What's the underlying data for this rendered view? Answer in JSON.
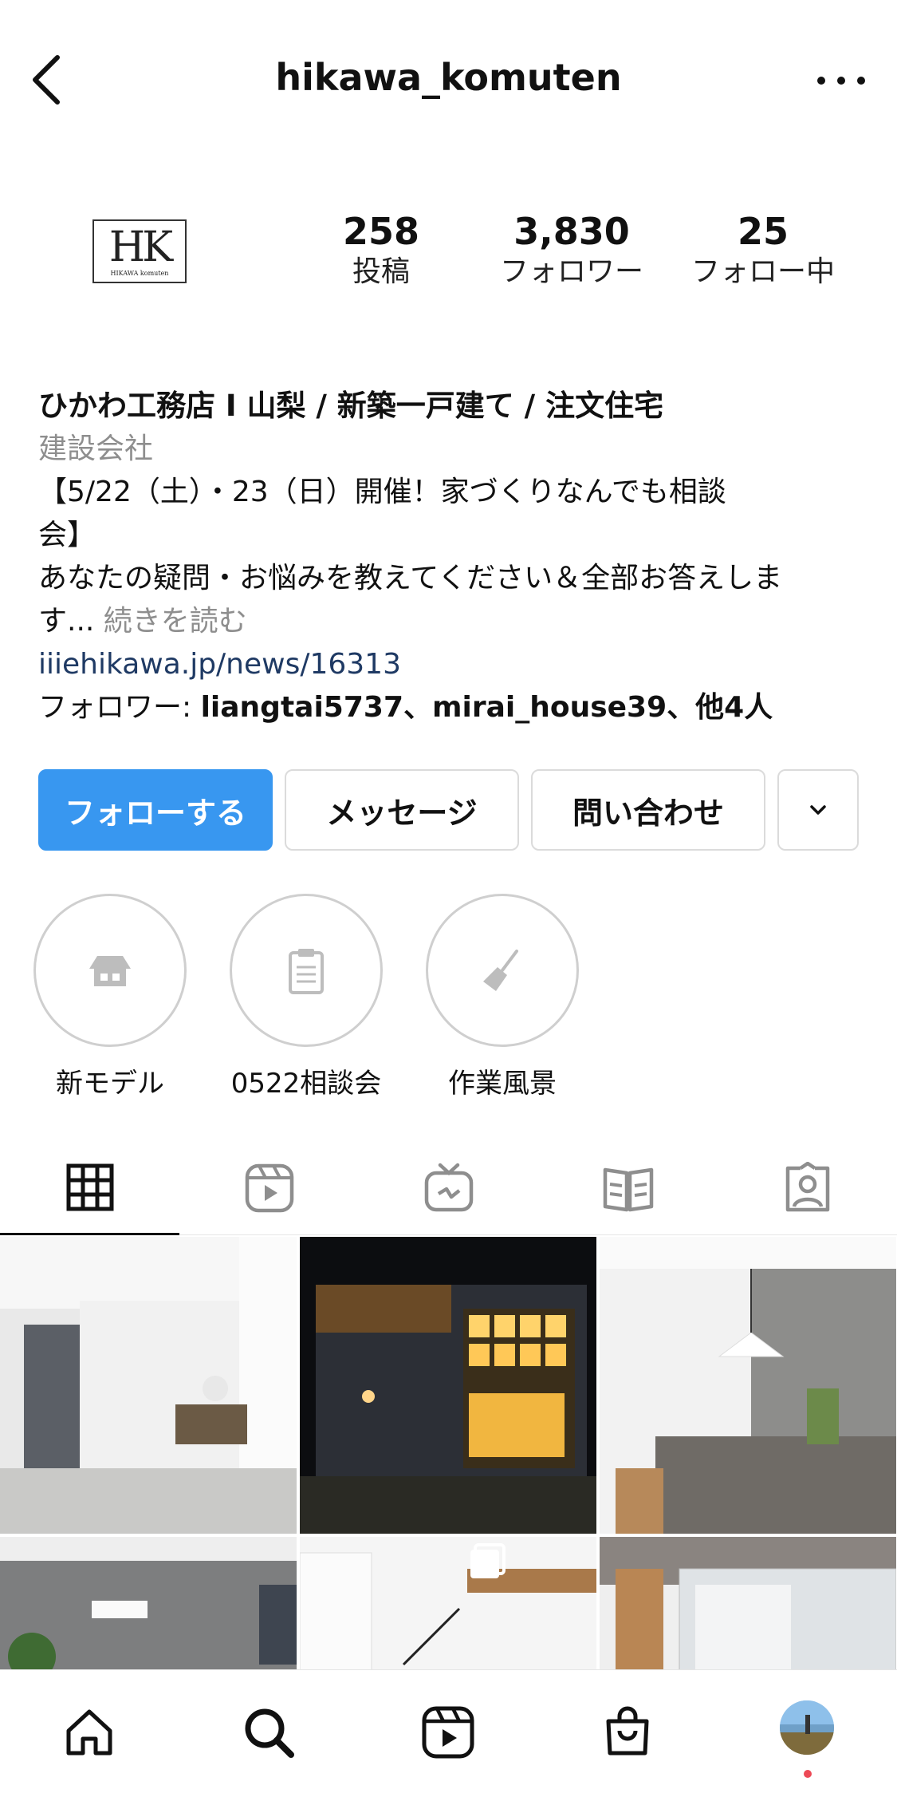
{
  "header": {
    "username": "hikawa_komuten"
  },
  "profile": {
    "logo_letters": "HK",
    "logo_sub": "HIKAWA komuten",
    "stats": [
      {
        "value": "258",
        "label": "投稿"
      },
      {
        "value": "3,830",
        "label": "フォロワー"
      },
      {
        "value": "25",
        "label": "フォロー中"
      }
    ]
  },
  "bio": {
    "name": "ひかわ工務店 I 山梨 / 新築一戸建て / 注文住宅",
    "category": "建設会社",
    "line1": "【5/22（土）・23（日）開催！家づくりなんでも相談",
    "line2": "会】",
    "line3": "あなたの疑問・お悩みを教えてください＆全部お答えしま",
    "line4_text": "す...",
    "line4_more": "続きを読む",
    "link": "iiiehikawa.jp/news/16313",
    "followers_prefix": "フォロワー: ",
    "followers_names": "liangtai5737、mirai_house39、他4人"
  },
  "buttons": {
    "follow": "フォローする",
    "message": "メッセージ",
    "contact": "問い合わせ"
  },
  "highlights": [
    {
      "label": "新モデル",
      "icon": "house-icon"
    },
    {
      "label": "0522相談会",
      "icon": "clipboard-icon"
    },
    {
      "label": "作業風景",
      "icon": "broom-icon"
    }
  ],
  "tabs": [
    {
      "name": "grid-icon",
      "active": true
    },
    {
      "name": "reels-icon",
      "active": false
    },
    {
      "name": "igtv-icon",
      "active": false
    },
    {
      "name": "guides-icon",
      "active": false
    },
    {
      "name": "tagged-icon",
      "active": false
    }
  ],
  "bottom_nav": [
    "home-icon",
    "search-icon",
    "reels-icon",
    "shop-icon",
    "profile-avatar"
  ]
}
